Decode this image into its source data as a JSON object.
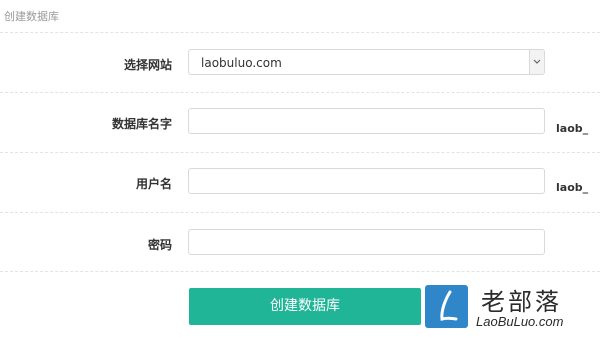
{
  "page": {
    "title": "创建数据库"
  },
  "form": {
    "site": {
      "label": "选择网站",
      "value": "laobuluo.com"
    },
    "db_name": {
      "label": "数据库名字",
      "value": "",
      "suffix": "laob_"
    },
    "username": {
      "label": "用户名",
      "value": "",
      "suffix": "laob_"
    },
    "password": {
      "label": "密码",
      "value": ""
    },
    "submit_label": "创建数据库"
  },
  "watermark": {
    "chinese": "老部落",
    "english": "LaoBuLuo.com"
  },
  "colors": {
    "accent": "#20b597",
    "logo_blue": "#2f86c8"
  }
}
